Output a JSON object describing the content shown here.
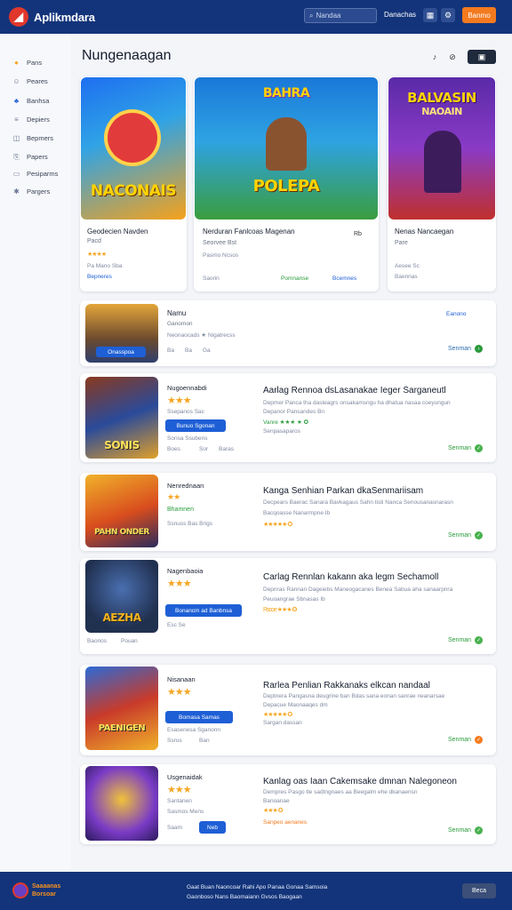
{
  "app": {
    "brand": "Aplikmdara",
    "search_placeholder": "Nandaa",
    "nav_link": "Danachas",
    "cta": "Banmo"
  },
  "sidebar": {
    "items": [
      {
        "label": "Pans",
        "icon": "coin-icon"
      },
      {
        "label": "Peares",
        "icon": "user-icon"
      },
      {
        "label": "Banhsa",
        "icon": "people-icon"
      },
      {
        "label": "Depiers",
        "icon": "list-icon"
      },
      {
        "label": "Bepmers",
        "icon": "chat-icon"
      },
      {
        "label": "Papers",
        "icon": "document-icon"
      },
      {
        "label": "Pesiparms",
        "icon": "monitor-icon"
      },
      {
        "label": "Pargers",
        "icon": "gear-icon"
      }
    ]
  },
  "main": {
    "title": "Nungenaagan",
    "featured": [
      {
        "art_text": "NACONAIS",
        "title": "Geodecien Navden",
        "subtitle": "Pacd",
        "rating_text": "★★★★",
        "meta": "Pa Mano Sba",
        "badge": "Bepneres"
      },
      {
        "art_text": "POLEPA",
        "art_header": "BAHRA",
        "title": "Nerduran Fanlcoas Magenan",
        "subtitle": "Seorvee Bst",
        "meta": "Pasmo Ncsos",
        "action": "Rb",
        "chips": [
          "Saorin",
          "Pomnanse",
          "Bcemnes"
        ]
      },
      {
        "art_text": "NAOAIN",
        "art_header": "BALVASIN",
        "title": "Nenas Nancaegan",
        "subtitle": "Pare",
        "meta": "Aesee Sc",
        "badge": "Baennas"
      }
    ],
    "first_row": {
      "title": "Namu",
      "subtitle": "Ganomon",
      "meta": "Neonaocads ★ Nigatrecss",
      "tags": [
        "Ba",
        "Ba",
        "Ga"
      ],
      "art_btn": "Onasspoa",
      "side_action": "Eanono",
      "link": "Senman"
    },
    "rows": [
      {
        "art_text": "SONIS",
        "name": "Nugoennabdi",
        "stars": "★★★",
        "sub": "Ssepanos Sac",
        "btn": "Bunuo Sgonan",
        "meta": "Sonsa Ssubens",
        "chips": [
          "Boes",
          "Sor",
          "Baras"
        ],
        "headline": "Aarlag Rennoa dsLasanakae Ieger Sarganeutl",
        "desc1": "Depmer Panca tha dasteagrs onsakamsngu ha dhatua nasaa coeyungun",
        "desc2": "Depanor Pansandes Bn",
        "rating": "Vanre ★★★ ★ ✪",
        "meta2": "Senpasaparos",
        "link": "Senman"
      },
      {
        "art_text": "PAHN ONDER",
        "name": "Nenrednaan",
        "stars": "★★",
        "sub": "Bhamnen",
        "btn": "",
        "meta": "Ssnuss Bas Brigs",
        "chips": [],
        "headline": "Kanga Senhian Parkan dkaSenmariisam",
        "desc1": "Decpears Baerac Sanara Bavkagaus Sahn tisti Nanca Senousanasnarasn",
        "desc2": "Bacqoasse Nanarmpne Ib",
        "rating": "★★★★★ ✪",
        "meta2": "",
        "link": "Senman"
      },
      {
        "art_text": "AEZHA",
        "name": "Nagenbaoia",
        "stars": "★★★",
        "sub": "",
        "btn": "Bonancm ad Banbnsa",
        "meta": "Esc Se",
        "chips": [
          "Baonos",
          "Pouan"
        ],
        "headline": "Carlag Rennlan kakann aka legm Sechamoll",
        "desc1": "Depnras Rannan Dageiebs Maneogacanes Benea Sabua aha sanaarpnra",
        "desc2": "Peuoangrae Sbnasas Ib",
        "rating": "Rscoe ★★★ ✪",
        "meta2": "",
        "link": "Senman"
      },
      {
        "art_text": "PAENIGEN",
        "name": "Nisanaan",
        "stars": "★★★",
        "sub": "",
        "btn": "Bomasa Samas",
        "meta": "Esasenesa Sganonn",
        "chips": [
          "Ssrus",
          "Ban"
        ],
        "headline": "Rarlea Penlian Rakkanaks elkcan nandaal",
        "desc1": "Deptnera Pangasna deugrine ban Bdas sana eonan sanrae neanarsae",
        "desc2": "Depacue Maonaaqes dm",
        "rating": "★★★★★ ✪",
        "meta2": "Sargan dassan",
        "link": "Senman"
      },
      {
        "art_text": "",
        "name": "Usgenaidak",
        "stars": "★★★",
        "sub": "Santanen",
        "btn": "",
        "meta": "Sasmos Mens",
        "chips": [
          "Saam",
          "Neb"
        ],
        "headline": "Kanlag oas Iaan Cakemsake dmnan Nalegoneon",
        "desc1": "Dempres Pasgo tle sadtngnaes aa Beegalm ehe dkanaensn",
        "desc2": "Banoanae",
        "rating": "★★★ ✪",
        "meta2": "Sanpeo aenanes",
        "link": "Senman"
      }
    ]
  },
  "footer": {
    "brand_line1": "Saaaanas",
    "brand_line2": "Borsoar",
    "links_line1": "Gaat Buan Naoncoar  Rahi Apo  Panaa Gonaa Samsoia",
    "links_line2": "Gaonboso Nans Baomaiann Gvsos Baogaan",
    "button": "Beca"
  },
  "colors": {
    "header": "#13347a",
    "accent": "#f37a1f",
    "link": "#2a9a3c",
    "button": "#1e5fd6",
    "star": "#f5a623"
  }
}
